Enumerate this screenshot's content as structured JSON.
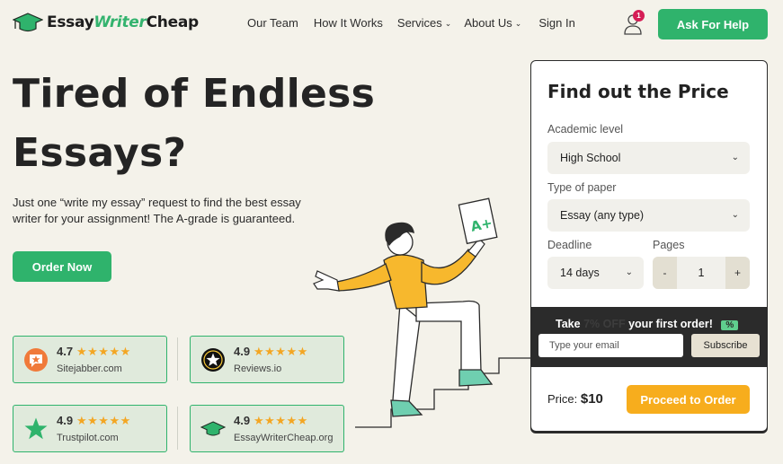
{
  "header": {
    "logo": {
      "part1": "Essay",
      "part2": "Writer",
      "part3": "Cheap"
    },
    "nav": [
      {
        "label": "Our Team"
      },
      {
        "label": "How It Works"
      },
      {
        "label": "Services"
      },
      {
        "label": "About Us"
      },
      {
        "label": "Sign In"
      }
    ],
    "notification_count": "1",
    "ask_button": "Ask For Help"
  },
  "hero": {
    "title_line1": "Tired of Endless",
    "title_line2": "Essays?",
    "subtitle": "Just one “write my essay” request to find the best essay writer for your assignment! The A-grade is guaranteed.",
    "order_button": "Order Now"
  },
  "ratings": [
    {
      "score": "4.7",
      "stars": "★★★★★",
      "source": "Sitejabber.com",
      "icon": "sitejabber-icon"
    },
    {
      "score": "4.9",
      "stars": "★★★★★",
      "source": "Reviews.io",
      "icon": "reviews-io-icon"
    },
    {
      "score": "4.9",
      "stars": "★★★★★",
      "source": "Trustpilot.com",
      "icon": "trustpilot-icon"
    },
    {
      "score": "4.9",
      "stars": "★★★★★",
      "source": "EssayWriterCheap.org",
      "icon": "graduation-cap-icon"
    }
  ],
  "illustration": {
    "paper_grade": "A+"
  },
  "price_card": {
    "title": "Find out the Price",
    "academic_level": {
      "label": "Academic level",
      "value": "High School"
    },
    "paper_type": {
      "label": "Type of paper",
      "value": "Essay (any type)"
    },
    "deadline": {
      "label": "Deadline",
      "value": "14 days"
    },
    "pages": {
      "label": "Pages",
      "value": "1",
      "minus": "-",
      "plus": "+"
    },
    "promo": {
      "take": "Take",
      "hidden": "7% OFF",
      "rest": "your first order!",
      "badge": "%",
      "email_placeholder": "Type your email",
      "subscribe": "Subscribe"
    },
    "price_label": "Price:",
    "price_value": "$10",
    "proceed_button": "Proceed to Order"
  },
  "colors": {
    "accent_green": "#2fb36c",
    "orange": "#f7ad1d",
    "background": "#f4f2ea",
    "badge_red": "#d51d55"
  }
}
